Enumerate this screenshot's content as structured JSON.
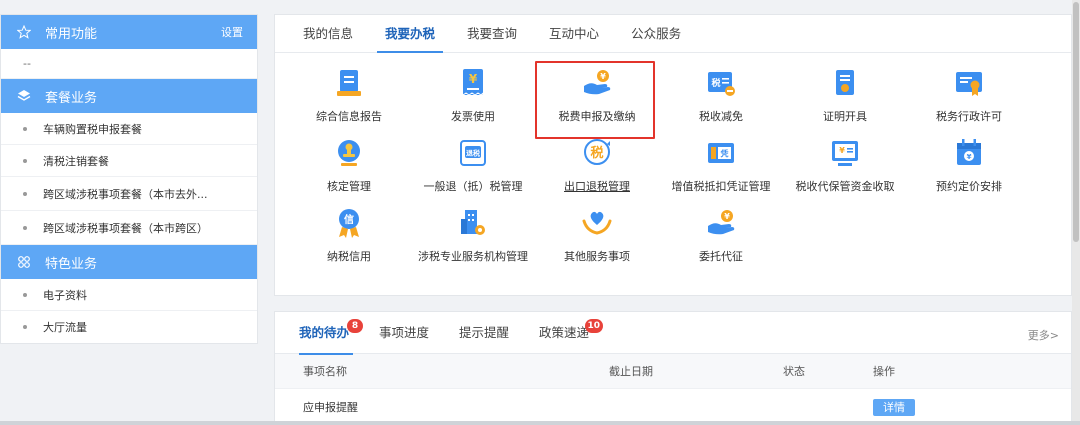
{
  "sidebar": {
    "common": {
      "label": "常用功能",
      "link": "设置"
    },
    "common_empty": "--",
    "packages": {
      "label": "套餐业务",
      "items": [
        {
          "label": "车辆购置税申报套餐"
        },
        {
          "label": "清税注销套餐"
        },
        {
          "label": "跨区域涉税事项套餐（本市去外..."
        },
        {
          "label": "跨区域涉税事项套餐（本市跨区）"
        }
      ]
    },
    "features": {
      "label": "特色业务",
      "items": [
        {
          "label": "电子资料"
        },
        {
          "label": "大厅流量"
        }
      ]
    }
  },
  "services": {
    "tabs": [
      {
        "label": "我的信息"
      },
      {
        "label": "我要办税"
      },
      {
        "label": "我要查询"
      },
      {
        "label": "互动中心"
      },
      {
        "label": "公众服务"
      }
    ],
    "items": [
      {
        "label": "综合信息报告",
        "icon": "report-icon"
      },
      {
        "label": "发票使用",
        "icon": "invoice-icon"
      },
      {
        "label": "税费申报及缴纳",
        "icon": "tax-payment-icon"
      },
      {
        "label": "税收减免",
        "icon": "tax-reduction-icon"
      },
      {
        "label": "证明开具",
        "icon": "certificate-icon"
      },
      {
        "label": "税务行政许可",
        "icon": "license-icon"
      },
      {
        "label": "核定管理",
        "icon": "stamp-icon"
      },
      {
        "label": "一般退（抵）税管理",
        "icon": "refund-icon"
      },
      {
        "label": "出口退税管理",
        "icon": "export-refund-icon"
      },
      {
        "label": "增值税抵扣凭证管理",
        "icon": "voucher-icon"
      },
      {
        "label": "税收代保管资金收取",
        "icon": "custody-fund-icon"
      },
      {
        "label": "预约定价安排",
        "icon": "calendar-icon"
      },
      {
        "label": "纳税信用",
        "icon": "credit-icon"
      },
      {
        "label": "涉税专业服务机构管理",
        "icon": "agency-icon"
      },
      {
        "label": "其他服务事项",
        "icon": "heart-hands-icon"
      },
      {
        "label": "委托代征",
        "icon": "delegate-icon"
      }
    ]
  },
  "todo": {
    "tabs": [
      {
        "label": "我的待办",
        "badge": "8"
      },
      {
        "label": "事项进度"
      },
      {
        "label": "提示提醒"
      },
      {
        "label": "政策速递",
        "badge": "10"
      }
    ],
    "more": "更多>",
    "columns": {
      "name": "事项名称",
      "date": "截止日期",
      "status": "状态",
      "op": "操作"
    },
    "rows": [
      {
        "name": "应申报提醒",
        "date": "",
        "status": "",
        "op": "详情"
      }
    ]
  },
  "colors": {
    "accent": "#5ea7f5",
    "tab_active": "#1f64b9",
    "highlight": "#e3342b",
    "badge": "#e8423a",
    "icon_blue": "#3c8ff0",
    "icon_orange": "#f5a623"
  }
}
